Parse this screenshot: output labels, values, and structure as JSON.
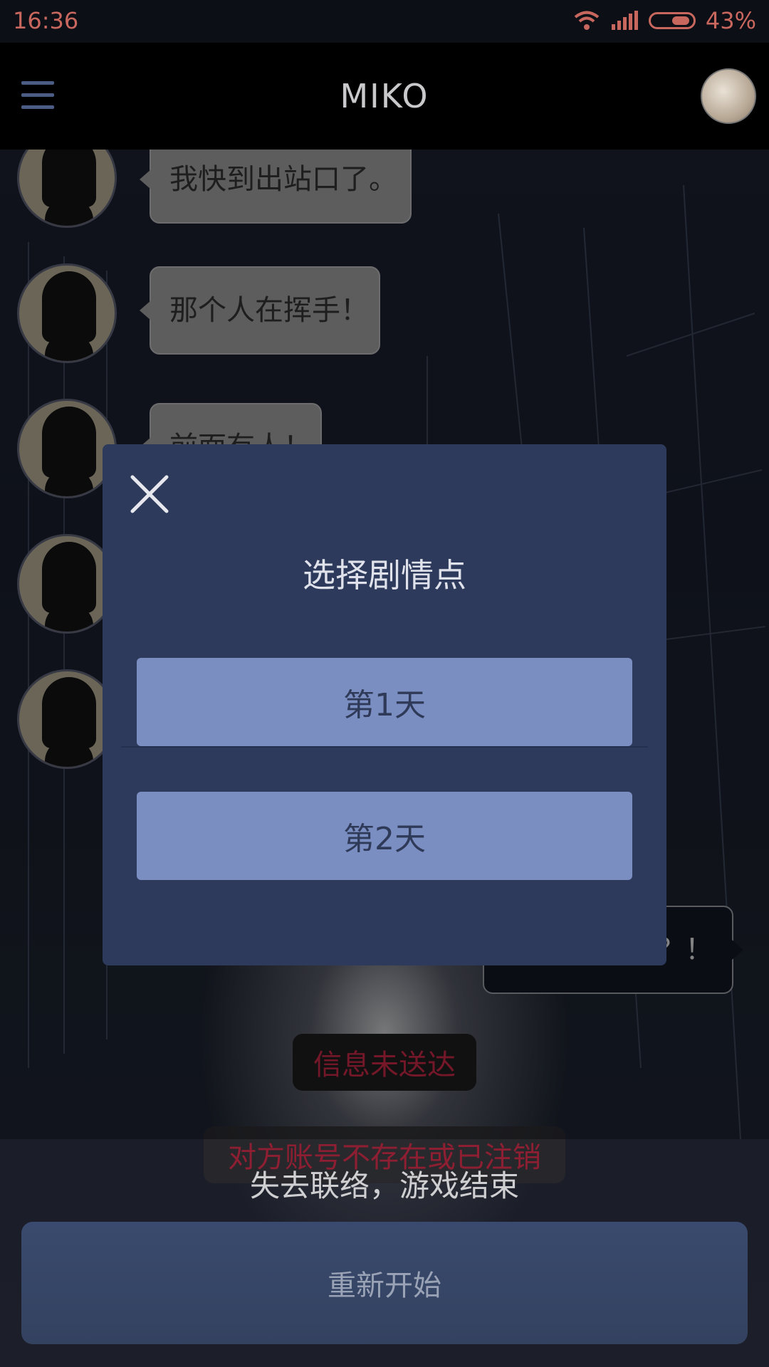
{
  "status_bar": {
    "time": "16:36",
    "battery_percent": "43%",
    "battery_level": 0.43
  },
  "app_bar": {
    "title": "MIKO"
  },
  "chat": {
    "messages_left": [
      {
        "text": "我快到出站口了。"
      },
      {
        "text": "那个人在挥手！"
      },
      {
        "text": "前面有人！"
      }
    ],
    "message_right": {
      "text": "了？！"
    },
    "notice_undelivered": "信息未送达",
    "notice_account": "对方账号不存在或已注销"
  },
  "game_over": {
    "text": "失去联络，游戏结束",
    "restart_label": "重新开始"
  },
  "dialog": {
    "title": "选择剧情点",
    "options": [
      {
        "label": "第1天"
      },
      {
        "label": "第2天"
      }
    ]
  }
}
